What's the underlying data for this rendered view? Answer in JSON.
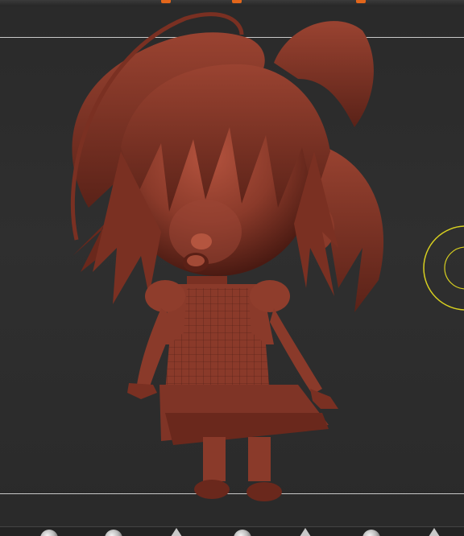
{
  "app": {
    "view": "3D viewport",
    "model_material_color": "#8a3a2a",
    "accent_color": "#e2661b",
    "gizmo_color": "#d8d020"
  },
  "toolbar_top": {
    "markers": [
      "marker-1",
      "marker-2",
      "marker-3"
    ]
  },
  "bottom_shelf": {
    "brushes": [
      {
        "icon": "sphere-brush-icon"
      },
      {
        "icon": "sphere-brush-icon"
      },
      {
        "icon": "cone-brush-icon"
      },
      {
        "icon": "sphere-brush-icon"
      },
      {
        "icon": "cone-brush-icon"
      },
      {
        "icon": "sphere-brush-icon"
      },
      {
        "icon": "cone-brush-icon"
      }
    ]
  }
}
